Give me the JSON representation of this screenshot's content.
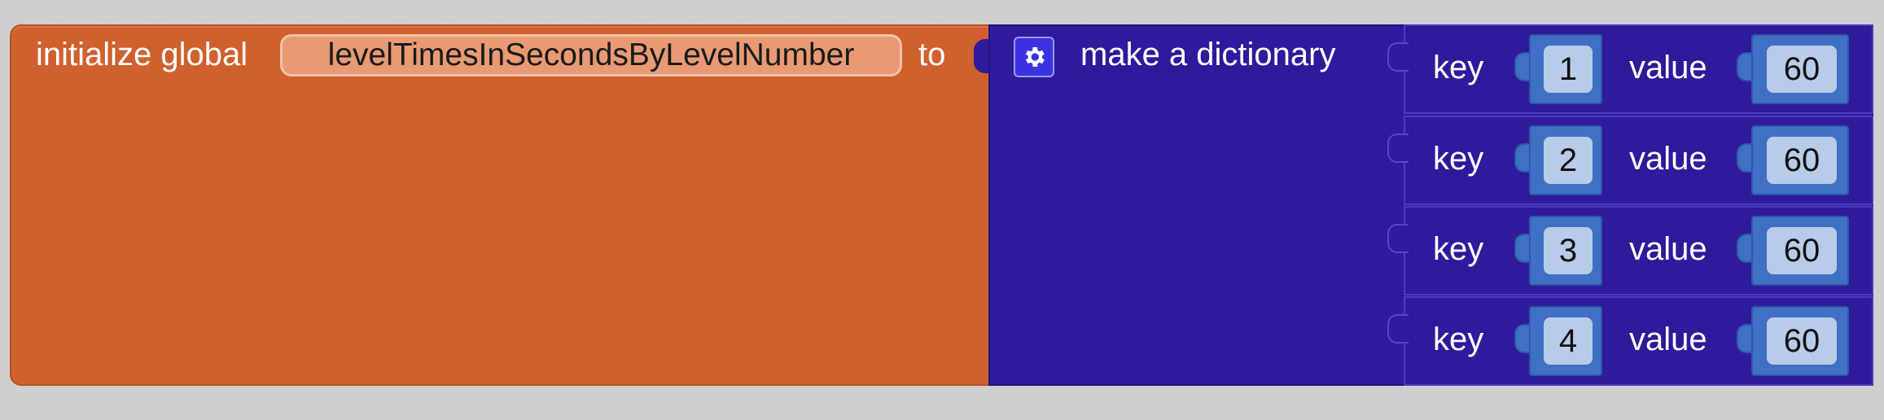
{
  "init_block": {
    "prefix": "initialize global",
    "variable_name": "levelTimesInSecondsByLevelNumber",
    "suffix": "to",
    "color": "#d0602e"
  },
  "dictionary_block": {
    "title": "make a dictionary",
    "gear_icon": "gear-icon",
    "color": "#2e1a9b",
    "pairs": [
      {
        "key_label": "key",
        "key": "1",
        "value_label": "value",
        "value": "60"
      },
      {
        "key_label": "key",
        "key": "2",
        "value_label": "value",
        "value": "60"
      },
      {
        "key_label": "key",
        "key": "3",
        "value_label": "value",
        "value": "60"
      },
      {
        "key_label": "key",
        "key": "4",
        "value_label": "value",
        "value": "60"
      }
    ]
  },
  "number_block_color": "#3f70c4"
}
